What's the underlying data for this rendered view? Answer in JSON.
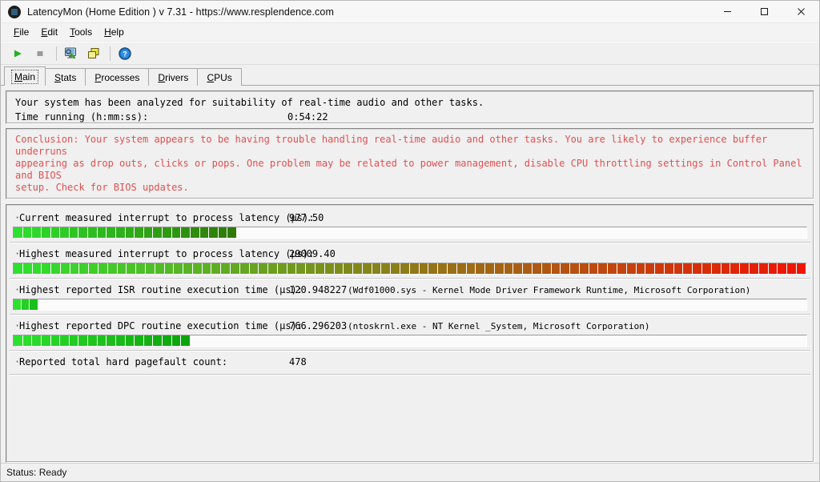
{
  "window": {
    "title": "LatencyMon  (Home Edition )  v 7.31 - https://www.resplendence.com",
    "icon": "app-circle-icon",
    "minimize": "—",
    "maximize": "☐",
    "close": "✕"
  },
  "menu": {
    "items": [
      {
        "label": "File",
        "accel": "F"
      },
      {
        "label": "Edit",
        "accel": "E"
      },
      {
        "label": "Tools",
        "accel": "T"
      },
      {
        "label": "Help",
        "accel": "H"
      }
    ]
  },
  "toolbar": {
    "buttons": [
      {
        "name": "start-button",
        "icon": "play-icon",
        "color": "#24b024"
      },
      {
        "name": "stop-button",
        "icon": "stop-square-icon",
        "color": "#9a9a9a"
      },
      {
        "name": "separator-1",
        "icon": "separator"
      },
      {
        "name": "analyze-button",
        "icon": "monitor-wrench-icon"
      },
      {
        "name": "windows-button",
        "icon": "cascade-windows-icon"
      },
      {
        "name": "separator-2",
        "icon": "separator"
      },
      {
        "name": "help-button",
        "icon": "question-help-icon"
      }
    ]
  },
  "tabs": [
    {
      "label": "Main",
      "accel": "M",
      "active": true
    },
    {
      "label": "Stats",
      "accel": "S",
      "active": false
    },
    {
      "label": "Processes",
      "accel": "P",
      "active": false
    },
    {
      "label": "Drivers",
      "accel": "D",
      "active": false
    },
    {
      "label": "CPUs",
      "accel": "C",
      "active": false
    }
  ],
  "summary": {
    "headline": "Your system has been analyzed for suitability of real-time audio and other tasks.",
    "time_label": "Time running (h:mm:ss):",
    "time_value": "0:54:22"
  },
  "conclusion": {
    "color": "#e05050",
    "lines": [
      "Conclusion: Your system appears to be having trouble handling real-time audio and other tasks. You are likely to experience buffer underruns",
      "appearing as drop outs, clicks or pops. One problem may be related to power management, disable CPU throttling settings in Control Panel and BIOS",
      "setup. Check for BIOS updates."
    ]
  },
  "metrics": [
    {
      "name": "current-measured-latency",
      "label": "Current measured interrupt to process latency (µs):",
      "value": "977.50",
      "extra": "",
      "bar": {
        "fill_percent": 28.2,
        "segments": 24,
        "start_color": "#2ee02e",
        "end_color": "#2f7a06"
      }
    },
    {
      "name": "highest-measured-latency",
      "label": "Highest measured interrupt to process latency (µs):",
      "value": "29009.40",
      "extra": "",
      "bar": {
        "fill_percent": 100,
        "segments": 84,
        "start_color": "#2ee02e",
        "end_color": "#ef1505"
      }
    },
    {
      "name": "highest-isr-execution-time",
      "label": "Highest reported ISR routine execution time (µs):",
      "value": "120.948227",
      "extra": "(Wdf01000.sys - Kernel Mode Driver Framework Runtime, Microsoft Corporation)",
      "bar": {
        "fill_percent": 3.1,
        "segments": 3,
        "start_color": "#2ee02e",
        "end_color": "#18c018"
      }
    },
    {
      "name": "highest-dpc-execution-time",
      "label": "Highest reported DPC routine execution time (µs):",
      "value": "766.296203",
      "extra": "(ntoskrnl.exe - NT Kernel _System, Microsoft Corporation)",
      "bar": {
        "fill_percent": 22.3,
        "segments": 19,
        "start_color": "#2ee02e",
        "end_color": "#0ba30b"
      }
    },
    {
      "name": "reported-hard-pagefault-count",
      "label": "Reported total hard pagefault count:",
      "value": "478",
      "extra": "",
      "bar": null
    }
  ],
  "statusbar": {
    "text": "Status: Ready"
  }
}
